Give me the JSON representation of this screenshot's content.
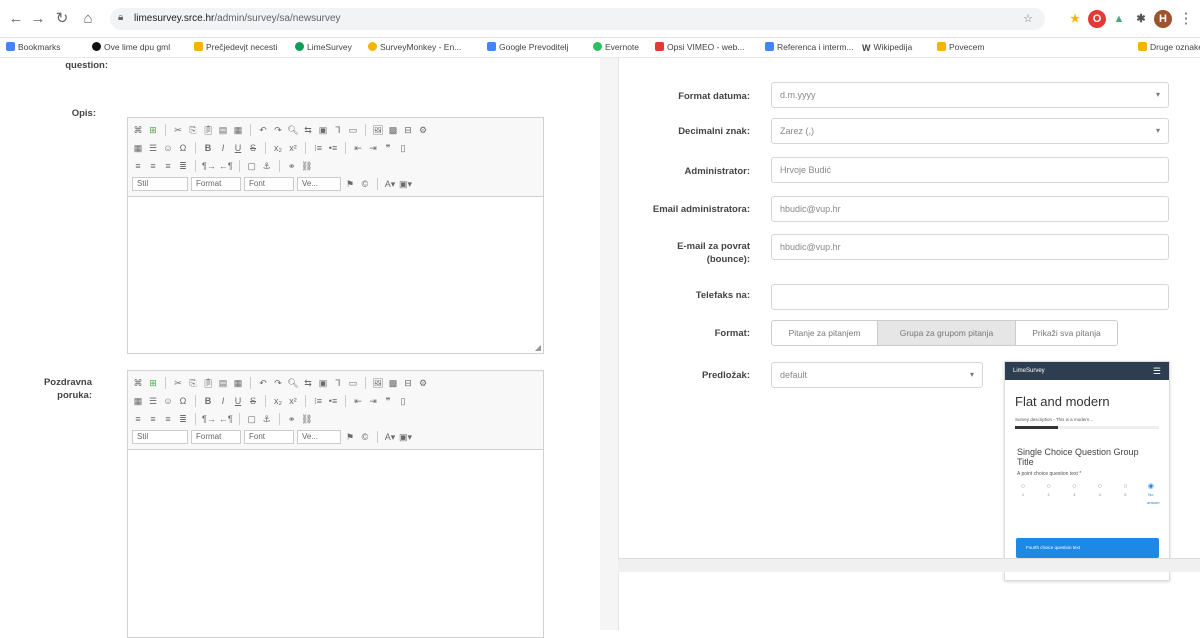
{
  "browser": {
    "url_host": "limesurvey.srce.hr",
    "url_path": "/admin/survey/sa/newsurvey",
    "bookmarks": [
      {
        "label": "Bookmarks",
        "color": "#4285f4"
      },
      {
        "label": "Ove lime dpu gml",
        "color": "#111111"
      },
      {
        "label": "Prečjedevjt necesti",
        "color": "#f4b400"
      },
      {
        "label": "LimeSurvey",
        "color": "#0f9d58"
      },
      {
        "label": "SurveyMonkey - En...",
        "color": "#f4b400"
      },
      {
        "label": "Google Prevoditelj",
        "color": "#4285f4"
      },
      {
        "label": "Evernote",
        "color": "#2dbe60"
      },
      {
        "label": "Opsi VIMEO - web...",
        "color": "#e53935"
      },
      {
        "label": "Referenca i interm...",
        "color": "#4285f4"
      },
      {
        "label": "Wikipedija",
        "color": "#444444"
      },
      {
        "label": "Povecem",
        "color": "#f4b400"
      },
      {
        "label": "Druge oznake",
        "color": "#f4b400"
      }
    ]
  },
  "left": {
    "top_label": "question:",
    "opis_label": "Opis:",
    "pozdravna_label": "Pozdravna poruka:",
    "toolbar": {
      "source": "⌘ Izv",
      "styles_combo": "Stil",
      "format_combo": "Format",
      "font_combo": "Font",
      "size_combo": "Ve..."
    }
  },
  "right": {
    "format_datuma": {
      "label": "Format datuma:",
      "value": "d.m.yyyy"
    },
    "decimalni_znak": {
      "label": "Decimalni znak:",
      "value": "Zarez (,)"
    },
    "administrator": {
      "label": "Administrator:",
      "value": "Hrvoje Budić"
    },
    "email_admin": {
      "label": "Email administratora:",
      "value": "hbudic@vup.hr"
    },
    "email_bounce": {
      "label": "E-mail za povrat (bounce):",
      "value": "hbudic@vup.hr"
    },
    "faks": {
      "label": "Telefaks na:",
      "value": ""
    },
    "format": {
      "label": "Format:",
      "options": [
        "Pitanje za pitanjem",
        "Grupa za grupom pitanja",
        "Prikaži sva pitanja"
      ],
      "selected_index": 1
    },
    "predlozak": {
      "label": "Predložak:",
      "value": "default"
    }
  },
  "preview": {
    "brand": "LimeSurvey",
    "title": "Flat and modern",
    "description": "Survey description - This is a modern...",
    "progress_percent": 30,
    "group_title": "Single Choice Question Group Title",
    "question": "A point choice question text *",
    "choices": [
      "1",
      "2",
      "3",
      "4",
      "5",
      "No answer"
    ],
    "selected_choice": 5,
    "button_label": "Fourth choice question text"
  },
  "colors": {
    "accent": "#1e88e5",
    "preview_bar": "#2c3e50"
  }
}
